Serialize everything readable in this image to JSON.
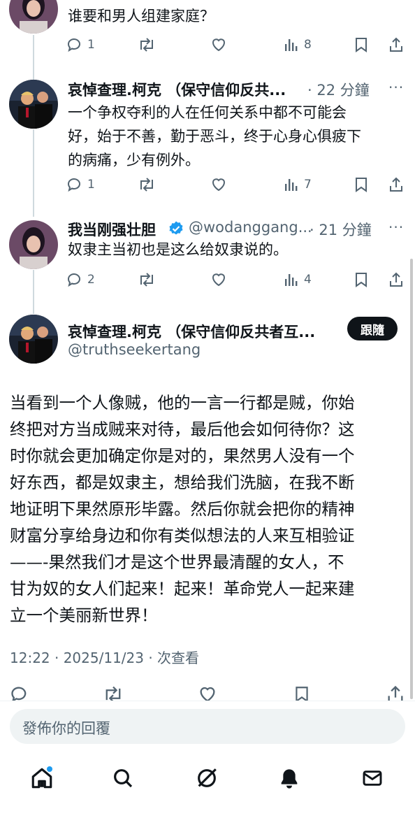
{
  "top_post": {
    "text": "谁要和男人组建家庭？",
    "reply_count": "1",
    "view_count": "8"
  },
  "reply1": {
    "name": "哀悼查理.柯克 （保守信仰反共...",
    "time": "· 22 分鐘",
    "more": "···",
    "lines": [
      "一个争权夺利的人在任何关系中都不可能会",
      "好，始于不善，勤于恶斗，终于心身心俱疲下",
      "的病痛，少有例外。"
    ],
    "reply_count": "1",
    "view_count": "7"
  },
  "reply2": {
    "name": "我当刚强壮胆",
    "handle": "@wodanggang...",
    "time": "· 21 分鐘",
    "more": "···",
    "text": "奴隶主当初也是这么给奴隶说的。",
    "reply_count": "2",
    "view_count": "4"
  },
  "main_post": {
    "name": "哀悼查理.柯克 （保守信仰反共者互...",
    "handle": "@truthseekertang",
    "follow_label": "跟隨",
    "lines": [
      "当看到一个人像贼，他的一言一行都是贼，你始",
      "终把对方当成贼来对待，最后他会如何待你？这",
      "时你就会更加确定你是对的，果然男人没有一个",
      "好东西，都是奴隶主，想给我们洗脑，在我不断",
      "地证明下果然原形毕露。然后你就会把你的精神",
      "财富分享给身边和你有类似想法的人来互相验证",
      "——-果然我们才是这个世界最清醒的女人，不",
      "甘为奴的女人们起来！起来！革命党人一起来建",
      "立一个美丽新世界！"
    ],
    "timestamp": "12:22 · 2025/11/23 · 次查看"
  },
  "reply_input": {
    "placeholder": "發佈你的回覆"
  },
  "bottom_nav": [
    "home-icon",
    "search-icon",
    "grok-icon",
    "notifications-icon",
    "messages-icon"
  ],
  "colors": {
    "accent": "#1d9bf0",
    "muted": "#536471",
    "follow_bg": "#0f1419"
  }
}
